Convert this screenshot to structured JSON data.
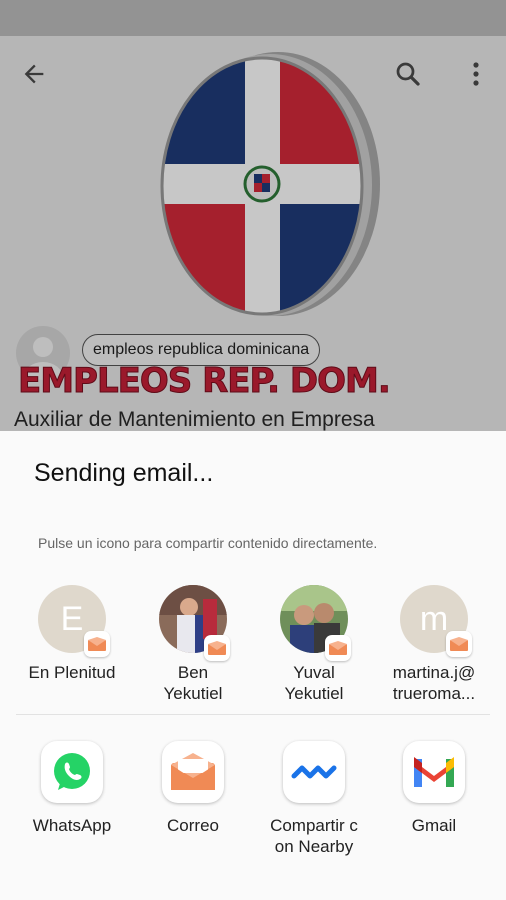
{
  "background": {
    "channel_name": "empleos republica dominicana",
    "logo_text": "EMPLEOS REP. DOM.",
    "job_title": "Auxiliar de Mantenimiento en Empresa"
  },
  "topbar": {
    "back_icon": "arrow-left-icon",
    "search_icon": "search-icon",
    "more_icon": "more-vert-icon"
  },
  "share_sheet": {
    "title": "Sending email...",
    "hint": "Pulse un icono para compartir contenido directamente.",
    "contacts": [
      {
        "label_line1": "En Plenitud",
        "label_line2": "",
        "avatar_letter": "E",
        "avatar_color": "#dfd8cc"
      },
      {
        "label_line1": "Ben",
        "label_line2": "Yekutiel",
        "avatar_letter": "",
        "avatar_color": ""
      },
      {
        "label_line1": "Yuval",
        "label_line2": "Yekutiel",
        "avatar_letter": "",
        "avatar_color": ""
      },
      {
        "label_line1": "martina.j@",
        "label_line2": "trueroma...",
        "avatar_letter": "m",
        "avatar_color": "#dfd8cc"
      }
    ],
    "apps": [
      {
        "label_line1": "WhatsApp",
        "label_line2": "",
        "icon": "whatsapp-icon"
      },
      {
        "label_line1": "Correo",
        "label_line2": "",
        "icon": "email-envelope-icon"
      },
      {
        "label_line1": "Compartir c",
        "label_line2": "on Nearby",
        "icon": "nearby-share-icon"
      },
      {
        "label_line1": "Gmail",
        "label_line2": "",
        "icon": "gmail-icon"
      }
    ]
  },
  "colors": {
    "flag_blue": "#1f3c7a",
    "flag_red": "#d42a3a",
    "email_badge": "#f08a55",
    "whatsapp_green": "#25d366"
  }
}
